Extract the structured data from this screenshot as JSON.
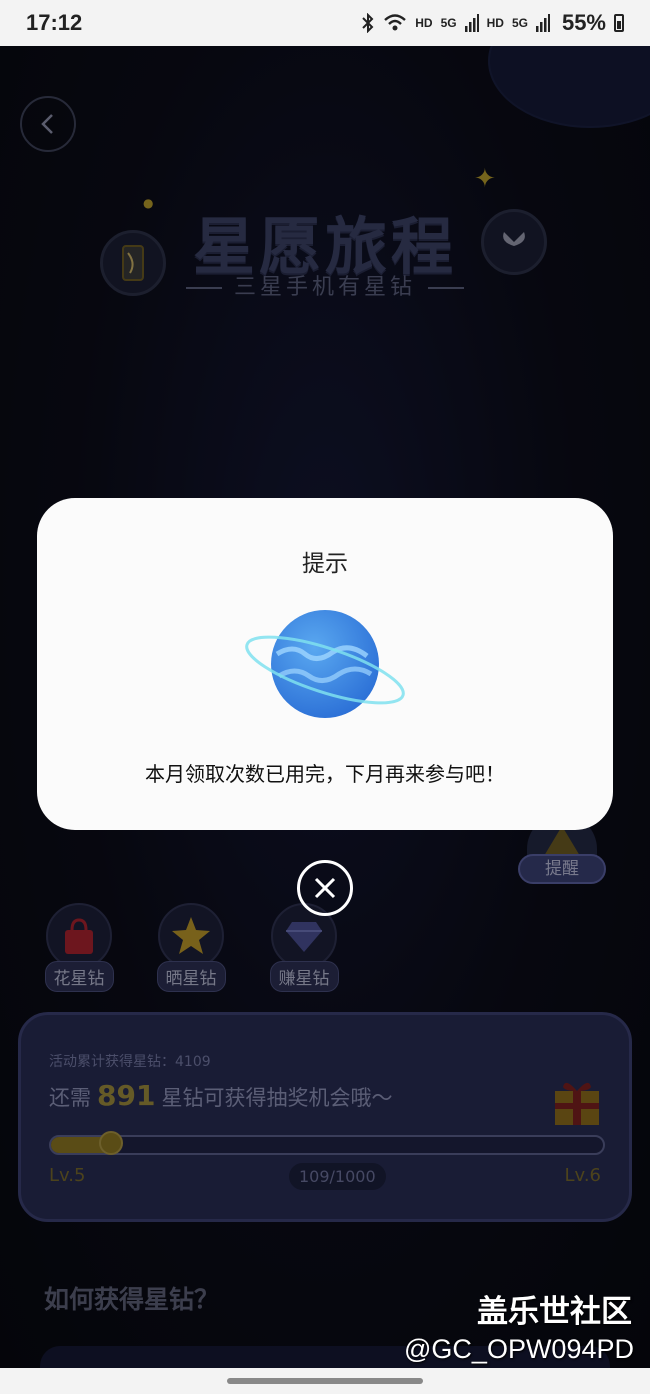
{
  "status_bar": {
    "time": "17:12",
    "network_label_1": "HD",
    "network_label_2": "HD",
    "signal_1": "5G",
    "signal_2": "5G",
    "battery": "55%"
  },
  "hero": {
    "title": "星愿旅程",
    "subtitle": "三星手机有星钻"
  },
  "remind_button_label": "提醒",
  "methods": [
    {
      "label": "花星钻",
      "icon": "shopping-bag-icon"
    },
    {
      "label": "晒星钻",
      "icon": "star-icon"
    },
    {
      "label": "赚星钻",
      "icon": "diamond-icon"
    }
  ],
  "progress": {
    "total_text": "活动累计获得星钻：4109",
    "need_prefix": "还需",
    "need_value": "891",
    "need_suffix": "星钻可获得抽奖机会哦～",
    "level_left": "Lv.5",
    "level_right": "Lv.6",
    "count": "109/1000",
    "fraction": 0.109
  },
  "how_title": "如何获得星钻？",
  "dialog": {
    "title": "提示",
    "message": "本月领取次数已用完，下月再来参与吧！",
    "icon": "planet-icon"
  },
  "watermark": {
    "title": "盖乐世社区",
    "user": "@GC_OPW094PD"
  },
  "colors": {
    "background": "#0b0c16",
    "card": "#272b52",
    "accent_gold": "#8a7622",
    "dialog_bg": "#fbfbfb"
  }
}
